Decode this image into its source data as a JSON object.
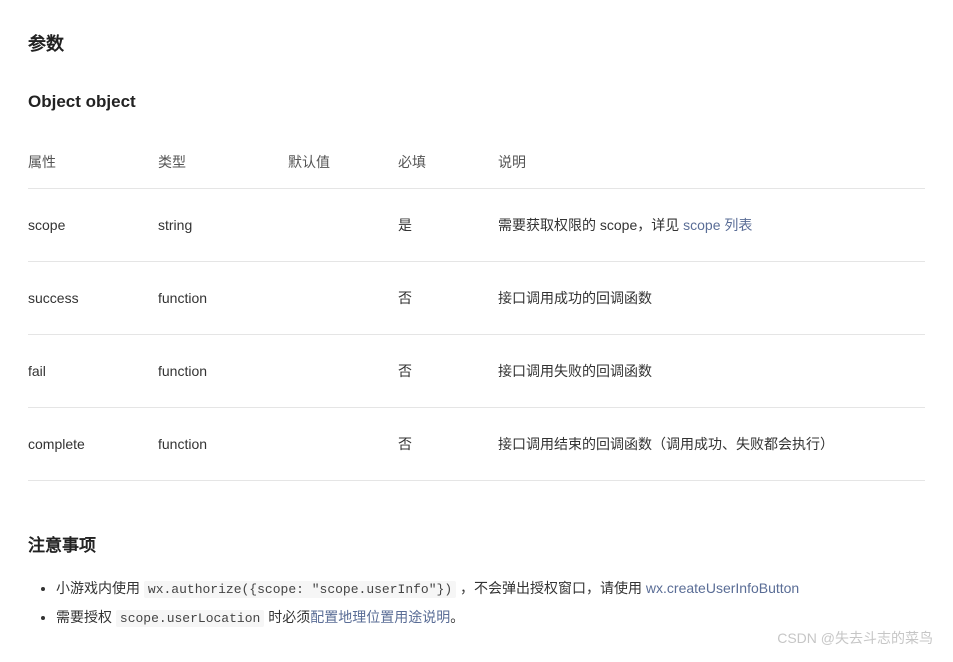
{
  "headings": {
    "params": "参数",
    "object": "Object object",
    "notes": "注意事项"
  },
  "table": {
    "headers": {
      "attr": "属性",
      "type": "类型",
      "default": "默认值",
      "required": "必填",
      "desc": "说明"
    },
    "rows": [
      {
        "attr": "scope",
        "type": "string",
        "default": "",
        "required": "是",
        "desc_prefix": "需要获取权限的 scope，详见 ",
        "desc_link": "scope 列表",
        "desc_suffix": ""
      },
      {
        "attr": "success",
        "type": "function",
        "default": "",
        "required": "否",
        "desc_prefix": "接口调用成功的回调函数",
        "desc_link": "",
        "desc_suffix": ""
      },
      {
        "attr": "fail",
        "type": "function",
        "default": "",
        "required": "否",
        "desc_prefix": "接口调用失败的回调函数",
        "desc_link": "",
        "desc_suffix": ""
      },
      {
        "attr": "complete",
        "type": "function",
        "default": "",
        "required": "否",
        "desc_prefix": "接口调用结束的回调函数（调用成功、失败都会执行）",
        "desc_link": "",
        "desc_suffix": ""
      }
    ]
  },
  "notes": {
    "item1_prefix": "小游戏内使用 ",
    "item1_code": "wx.authorize({scope: \"scope.userInfo\"})",
    "item1_middle": " ，不会弹出授权窗口，请使用 ",
    "item1_link": "wx.createUserInfoButton",
    "item2_prefix": "需要授权 ",
    "item2_code": "scope.userLocation",
    "item2_middle": " 时必须",
    "item2_link": "配置地理位置用途说明",
    "item2_suffix": "。"
  },
  "watermark": "CSDN @失去斗志的菜鸟"
}
